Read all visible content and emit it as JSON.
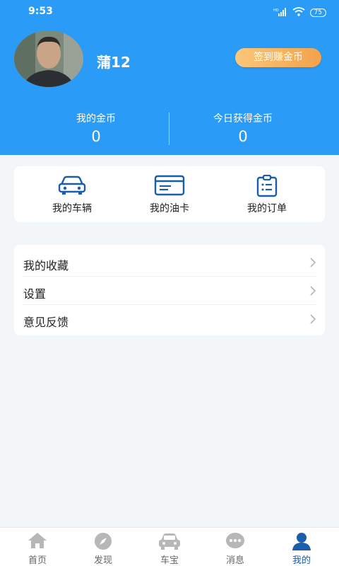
{
  "status_bar": {
    "time": "9:53",
    "network": "HD",
    "battery": "75"
  },
  "profile": {
    "username": "蒲12",
    "checkin_label": "签到赚金币"
  },
  "stats": [
    {
      "label": "我的金币",
      "value": "0"
    },
    {
      "label": "今日获得金币",
      "value": "0"
    }
  ],
  "quick_actions": [
    {
      "label": "我的车辆",
      "icon": "car-icon"
    },
    {
      "label": "我的油卡",
      "icon": "card-icon"
    },
    {
      "label": "我的订单",
      "icon": "clipboard-icon"
    }
  ],
  "menu": [
    {
      "label": "我的收藏"
    },
    {
      "label": "设置"
    },
    {
      "label": "意见反馈"
    }
  ],
  "tabbar": [
    {
      "label": "首页",
      "icon": "home-icon"
    },
    {
      "label": "发现",
      "icon": "compass-icon"
    },
    {
      "label": "车宝",
      "icon": "car-icon"
    },
    {
      "label": "消息",
      "icon": "message-icon"
    },
    {
      "label": "我的",
      "icon": "user-icon"
    }
  ],
  "colors": {
    "primary": "#2a9cf7",
    "accent": "#1b5cab",
    "checkin_start": "#fbc779",
    "checkin_end": "#f3a24b",
    "background": "#f3f6f9"
  }
}
